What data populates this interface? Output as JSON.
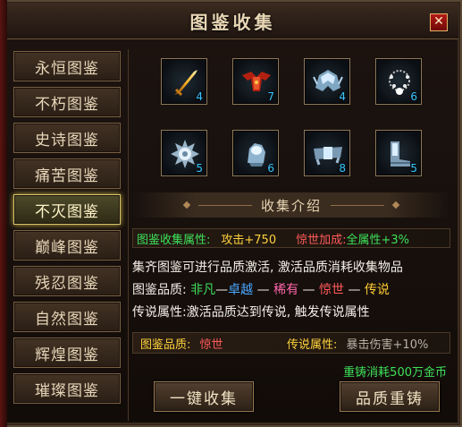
{
  "window": {
    "title": "图鉴收集",
    "close_label": "✕"
  },
  "sidebar": {
    "items": [
      {
        "label": "永恒图鉴",
        "active": false
      },
      {
        "label": "不朽图鉴",
        "active": false
      },
      {
        "label": "史诗图鉴",
        "active": false
      },
      {
        "label": "痛苦图鉴",
        "active": false
      },
      {
        "label": "不灭图鉴",
        "active": true
      },
      {
        "label": "巅峰图鉴",
        "active": false
      },
      {
        "label": "残忍图鉴",
        "active": false
      },
      {
        "label": "自然图鉴",
        "active": false
      },
      {
        "label": "辉煌图鉴",
        "active": false
      },
      {
        "label": "璀璨图鉴",
        "active": false
      }
    ]
  },
  "collection": {
    "slots": [
      {
        "icon": "golden-dagger-icon",
        "count": "4"
      },
      {
        "icon": "red-winged-armor-icon",
        "count": "7"
      },
      {
        "icon": "blue-helmet-icon",
        "count": "4"
      },
      {
        "icon": "pearl-necklace-icon",
        "count": "6"
      },
      {
        "icon": "spiked-ring-icon",
        "count": "5"
      },
      {
        "icon": "blue-gauntlet-icon",
        "count": "6"
      },
      {
        "icon": "blue-belt-icon",
        "count": "8"
      },
      {
        "icon": "blue-boots-icon",
        "count": "5"
      }
    ]
  },
  "intro": {
    "section_title": "收集介绍",
    "attr_label": "图鉴收集属性:",
    "attr_value": "攻击+750",
    "bonus_label": "惊世加成:",
    "bonus_value": "全属性+3%",
    "desc_line1": "集齐图鉴可进行品质激活, 激活品质消耗收集物品",
    "quality_label": "图鉴品质:",
    "quality_chain": [
      "非凡",
      "卓越",
      "稀有",
      "惊世",
      "传说"
    ],
    "quality_sep": "—",
    "legend_line": "传说属性:激活品质达到传说, 触发传说属性"
  },
  "status": {
    "quality_label": "图鉴品质:",
    "quality_value": "惊世",
    "legend_label": "传说属性:",
    "legend_value": "暴击伤害+10%",
    "cost_text": "重铸消耗500万金币"
  },
  "actions": {
    "collect_all": "一键收集",
    "reforge": "品质重铸"
  },
  "colors": {
    "accent_gold": "#d7c46a",
    "count_blue": "#37c7ff",
    "green": "#3ee05a",
    "red": "#ff5a5a"
  }
}
